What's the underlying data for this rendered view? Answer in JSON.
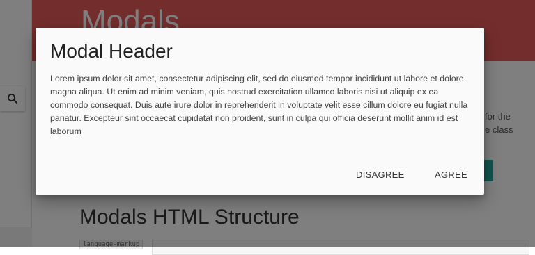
{
  "background": {
    "hero_title": "Modals",
    "hero_color": "#e85a5a",
    "paragraph_fragments": [
      "for the",
      "e class"
    ],
    "section_title": "Modals HTML Structure",
    "code_tab_label": "language-markup",
    "accent_button_color": "#26a69a",
    "search_icon": "search-icon"
  },
  "modal": {
    "header": "Modal Header",
    "body": "Lorem ipsum dolor sit amet, consectetur adipiscing elit, sed do eiusmod tempor incididunt ut labore et dolore magna aliqua. Ut enim ad minim veniam, quis nostrud exercitation ullamco laboris nisi ut aliquip ex ea commodo consequat. Duis aute irure dolor in reprehenderit in voluptate velit esse cillum dolore eu fugiat nulla pariatur. Excepteur sint occaecat cupidatat non proident, sunt in culpa qui officia deserunt mollit anim id est laborum",
    "footer": {
      "disagree_label": "DISAGREE",
      "agree_label": "AGREE"
    }
  }
}
